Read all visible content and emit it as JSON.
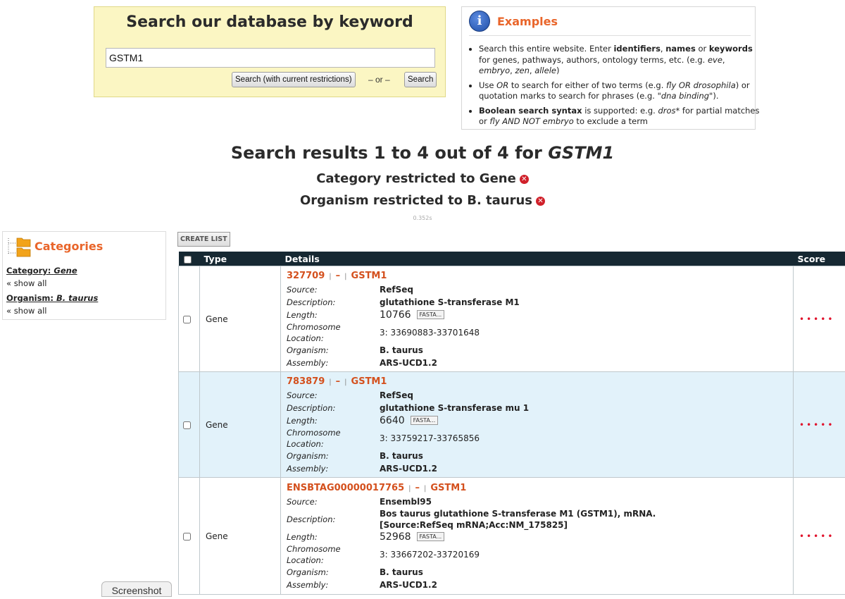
{
  "search": {
    "heading": "Search our database by keyword",
    "query": "GSTM1",
    "restricted_button": "Search (with current restrictions)",
    "or_text": "– or –",
    "search_button": "Search"
  },
  "examples": {
    "title": "Examples",
    "items": [
      "Search this entire website. Enter identifiers, names or keywords for genes, pathways, authors, ontology terms, etc. (e.g. eve, embryo, zen, allele)",
      "Use OR to search for either of two terms (e.g. fly OR drosophila) or quotation marks to search for phrases (e.g. \"dna binding\").",
      "Boolean search syntax is supported: e.g. dros* for partial matches or fly AND NOT embryo to exclude a term"
    ]
  },
  "results": {
    "title_prefix": "Search results 1 to 4 out of 4 for",
    "query": "GSTM1",
    "category_restriction": "Category restricted to Gene",
    "organism_restriction": "Organism restricted to B. taurus",
    "timing": "0.352s"
  },
  "categories": {
    "title": "Categories",
    "category_prefix": "Category:",
    "category_value": "Gene",
    "organism_prefix": "Organism:",
    "organism_value": "B. taurus",
    "show_all": "« show all"
  },
  "create_list": "CREATE LIST",
  "table": {
    "headers": {
      "type": "Type",
      "details": "Details",
      "score": "Score"
    },
    "labels": {
      "source": "Source:",
      "description": "Description:",
      "length": "Length:",
      "chromosome": "Chromosome",
      "location": "Location:",
      "organism": "Organism:",
      "assembly": "Assembly:",
      "fasta": "FASTA..."
    },
    "rows": [
      {
        "type": "Gene",
        "id": "327709",
        "dash": "–",
        "symbol": "GSTM1",
        "source": "RefSeq",
        "description": "glutathione S-transferase M1",
        "length": "10766",
        "location": "3: 33690883-33701648",
        "organism": "B. taurus",
        "assembly": "ARS-UCD1.2",
        "score": "•••••"
      },
      {
        "type": "Gene",
        "id": "783879",
        "dash": "–",
        "symbol": "GSTM1",
        "source": "RefSeq",
        "description": "glutathione S-transferase mu 1",
        "length": "6640",
        "location": "3: 33759217-33765856",
        "organism": "B. taurus",
        "assembly": "ARS-UCD1.2",
        "score": "•••••"
      },
      {
        "type": "Gene",
        "id": "ENSBTAG00000017765",
        "dash": "–",
        "symbol": "GSTM1",
        "source": "Ensembl95",
        "description": "Bos taurus glutathione S-transferase M1 (GSTM1), mRNA. [Source:RefSeq mRNA;Acc:NM_175825]",
        "length": "52968",
        "location": "3: 33667202-33720169",
        "organism": "B. taurus",
        "assembly": "ARS-UCD1.2",
        "score": "•••••"
      }
    ]
  },
  "screenshot_tab": "Screenshot",
  "colors": {
    "accent_orange": "#e9652a",
    "header_dark": "#162832",
    "row_highlight": "#e2f2fa",
    "search_bg": "#fbf6c3"
  }
}
